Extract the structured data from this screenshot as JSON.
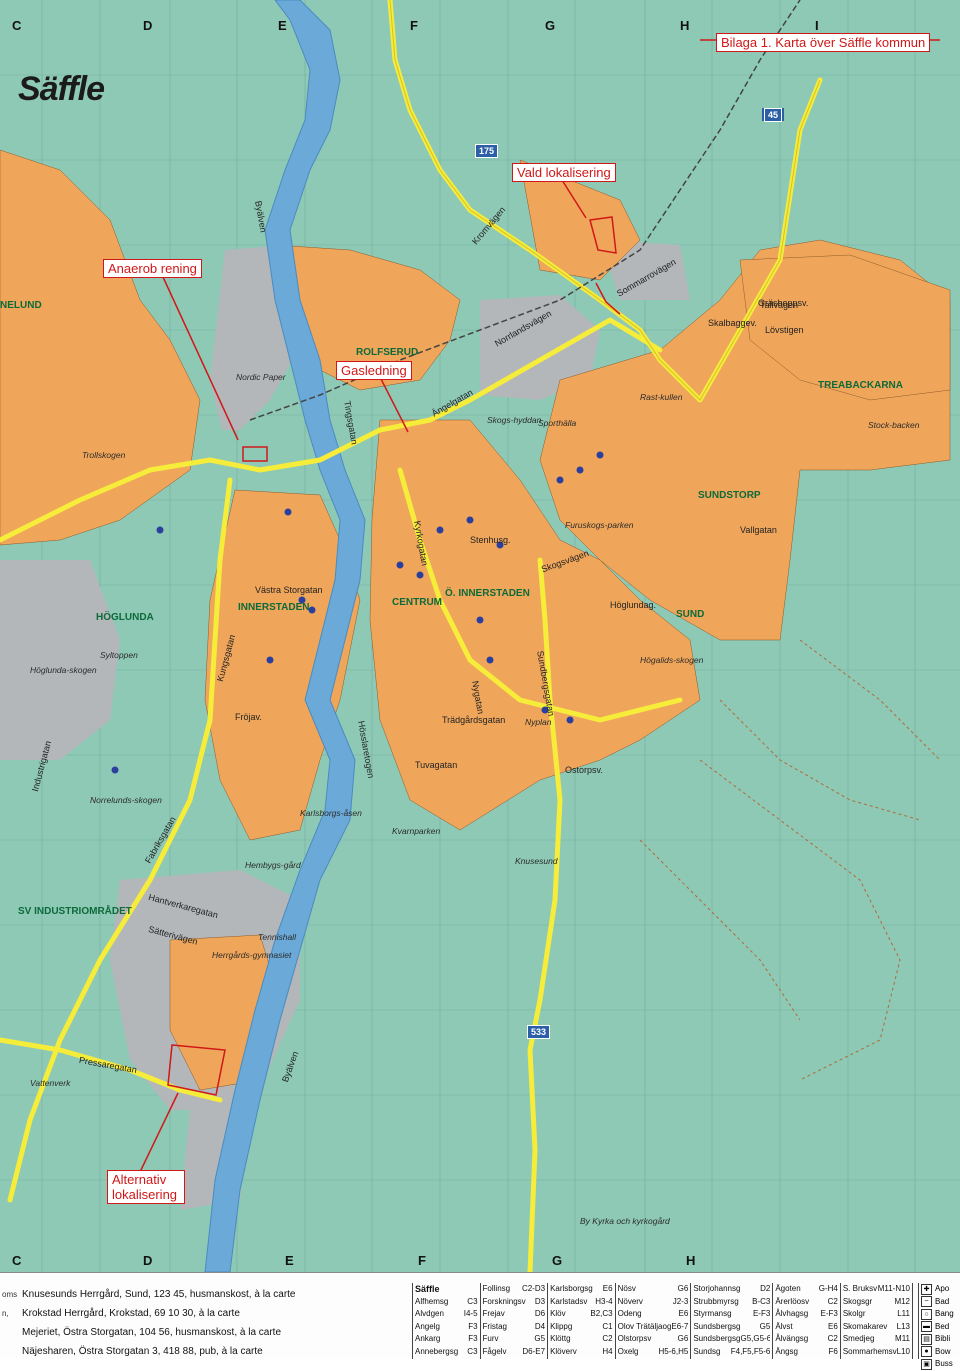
{
  "title": "Säffle",
  "heading_box": "Bilaga 1. Karta över Säffle kommun",
  "annotations": {
    "vald": "Vald lokalisering",
    "anaerob": "Anaerob rening",
    "gas": "Gasledning",
    "alternativ": "Alternativ lokalisering"
  },
  "colors": {
    "water": "#8ec9b6",
    "land": "#8ec9b6",
    "built": "#f0a65a",
    "industry": "#b4b7b9",
    "river": "#6aa9d8",
    "road": "#f6ec3a",
    "annotation": "#d01818"
  },
  "grid_top": [
    "C",
    "D",
    "E",
    "F",
    "G",
    "H",
    "I"
  ],
  "grid_bottom": [
    "C",
    "D",
    "E",
    "F",
    "G",
    "H"
  ],
  "route_numbers": [
    "45",
    "175",
    "533"
  ],
  "districts": [
    "ROLFSERUD",
    "TREABACKARNA",
    "SUNDSTORP",
    "INNERSTADEN",
    "CENTRUM",
    "Ö. INNERSTADEN",
    "SUND",
    "HÖGLUNDA",
    "SV INDUSTRIOMRÅDET",
    "NELUND"
  ],
  "road_labels": [
    "Kromvägen",
    "Sommarrovägen",
    "Tallvägen",
    "Skalbaggev.",
    "Lövstigen",
    "Gräshoppsv.",
    "Stenhusg.",
    "Kyrkogatan",
    "Västra Storgatan",
    "Byälven",
    "Industrigatan",
    "Pressaregatan",
    "Fabriksgatan",
    "Hantverkaregatan",
    "Sätterivägen",
    "Hösslaretogen",
    "Tingsgatan",
    "Höglundag.",
    "Skogsvägen",
    "Ostorpsv.",
    "Tuvagatan",
    "Trädgårdsgatan",
    "Norrlandsvägen",
    "Ängelgatan",
    "Sundbergsgatan",
    "Kungsgatan",
    "Nygatan",
    "Byälven",
    "Fröjav.",
    "Vallgatan"
  ],
  "area_labels": [
    "Nordic Paper",
    "Trollskogen",
    "Skogs-hyddan",
    "Sporthälla",
    "Rast-kullen",
    "Stock-backen",
    "Furuskogs-parken",
    "Höglunda-skogen",
    "Norrelunds-skogen",
    "Karlsborgs-åsen",
    "Hembygs-gård",
    "Tennishall",
    "Herrgårds-gymnasiet",
    "Kvarnparken",
    "Knusesund",
    "By Kyrka och kyrkogård",
    "Högalids-skogen",
    "Vattenverk",
    "Syltoppen",
    "Nyplan"
  ],
  "hotels": [
    {
      "cut": "oms",
      "text": "Knusesunds Herrgård, Sund, 123 45, husmanskost, à la carte"
    },
    {
      "cut": "n,",
      "text": "Krokstad Herrgård, Krokstad, 69 10 30, à la carte"
    },
    {
      "cut": "",
      "text": "Mejeriet, Östra Storgatan, 104 56, husmanskost, à la carte"
    },
    {
      "cut": "",
      "text": "Näjesharen, Östra Storgatan 3, 418 88, pub, à la carte"
    }
  ],
  "street_index": [
    [
      [
        "Säffle",
        ""
      ],
      [
        "Alfhemsg",
        "C3"
      ],
      [
        "Alvdgen",
        "I4-5"
      ],
      [
        "Angelg",
        "F3"
      ],
      [
        "Ankarg",
        "F3"
      ],
      [
        "Annebergsg",
        "C3"
      ]
    ],
    [
      [
        "Follinsg",
        "C2-D3"
      ],
      [
        "Forskningsv",
        "D3"
      ],
      [
        "Frejav",
        "D6"
      ],
      [
        "Fristag",
        "D4"
      ],
      [
        "Furv",
        "G5"
      ],
      [
        "Fågelv",
        "D6-E7"
      ]
    ],
    [
      [
        "Karlsborgsg",
        "E6"
      ],
      [
        "Karlstadsv",
        "H3-4"
      ],
      [
        "Klöv",
        "B2,C3"
      ],
      [
        "Klippg",
        "C1"
      ],
      [
        "Klöttg",
        "C2"
      ],
      [
        "Klöverv",
        "H4"
      ]
    ],
    [
      [
        "Nösv",
        "G6"
      ],
      [
        "Növerv",
        "J2-3"
      ],
      [
        "Odeng",
        "E6"
      ],
      [
        "Olov Trätäljaog",
        "E6-7"
      ],
      [
        "Olstorpsv",
        "G6"
      ],
      [
        "Oxelg",
        "H5-6,H5"
      ]
    ],
    [
      [
        "Storjohannsg",
        "D2"
      ],
      [
        "Strubbmyrsg",
        "B-C3"
      ],
      [
        "Styrmansg",
        "E-F3"
      ],
      [
        "Sundsbergsg",
        "G5"
      ],
      [
        "Sundsbergsg",
        "G5,G5-6"
      ],
      [
        "Sundsg",
        "F4,F5,F5-6"
      ]
    ],
    [
      [
        "Ägoten",
        "G-H4"
      ],
      [
        "Ärerlöosv",
        "C2"
      ],
      [
        "Ålvhagsg",
        "E-F3"
      ],
      [
        "Älvst",
        "E6"
      ],
      [
        "Ålvängsg",
        "C2"
      ],
      [
        "Ängsg",
        "F6"
      ]
    ],
    [
      [
        "S. Bruksv",
        "M11-N10"
      ],
      [
        "Skogsgr",
        "M12"
      ],
      [
        "Skolgr",
        "L11"
      ],
      [
        "Skomakarev",
        "L13"
      ],
      [
        "Smedjeg",
        "M11"
      ],
      [
        "Sommarhemsv",
        "L10"
      ]
    ]
  ],
  "symbols": [
    "Apo",
    "Bad",
    "Bang",
    "Bed",
    "Bibli",
    "Bow",
    "Buss"
  ]
}
